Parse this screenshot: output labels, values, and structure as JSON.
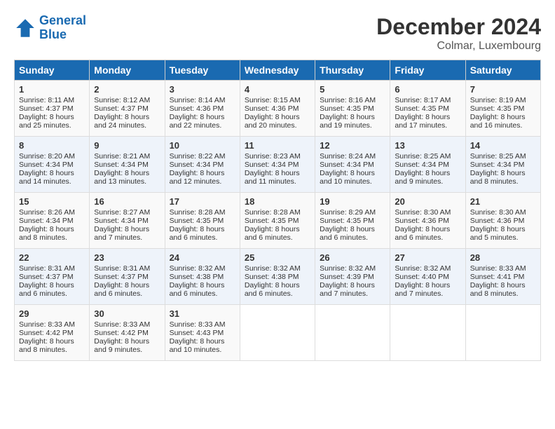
{
  "header": {
    "logo_line1": "General",
    "logo_line2": "Blue",
    "month": "December 2024",
    "location": "Colmar, Luxembourg"
  },
  "days_of_week": [
    "Sunday",
    "Monday",
    "Tuesday",
    "Wednesday",
    "Thursday",
    "Friday",
    "Saturday"
  ],
  "weeks": [
    [
      {
        "day": "1",
        "sunrise": "Sunrise: 8:11 AM",
        "sunset": "Sunset: 4:37 PM",
        "daylight": "Daylight: 8 hours and 25 minutes."
      },
      {
        "day": "2",
        "sunrise": "Sunrise: 8:12 AM",
        "sunset": "Sunset: 4:37 PM",
        "daylight": "Daylight: 8 hours and 24 minutes."
      },
      {
        "day": "3",
        "sunrise": "Sunrise: 8:14 AM",
        "sunset": "Sunset: 4:36 PM",
        "daylight": "Daylight: 8 hours and 22 minutes."
      },
      {
        "day": "4",
        "sunrise": "Sunrise: 8:15 AM",
        "sunset": "Sunset: 4:36 PM",
        "daylight": "Daylight: 8 hours and 20 minutes."
      },
      {
        "day": "5",
        "sunrise": "Sunrise: 8:16 AM",
        "sunset": "Sunset: 4:35 PM",
        "daylight": "Daylight: 8 hours and 19 minutes."
      },
      {
        "day": "6",
        "sunrise": "Sunrise: 8:17 AM",
        "sunset": "Sunset: 4:35 PM",
        "daylight": "Daylight: 8 hours and 17 minutes."
      },
      {
        "day": "7",
        "sunrise": "Sunrise: 8:19 AM",
        "sunset": "Sunset: 4:35 PM",
        "daylight": "Daylight: 8 hours and 16 minutes."
      }
    ],
    [
      {
        "day": "8",
        "sunrise": "Sunrise: 8:20 AM",
        "sunset": "Sunset: 4:34 PM",
        "daylight": "Daylight: 8 hours and 14 minutes."
      },
      {
        "day": "9",
        "sunrise": "Sunrise: 8:21 AM",
        "sunset": "Sunset: 4:34 PM",
        "daylight": "Daylight: 8 hours and 13 minutes."
      },
      {
        "day": "10",
        "sunrise": "Sunrise: 8:22 AM",
        "sunset": "Sunset: 4:34 PM",
        "daylight": "Daylight: 8 hours and 12 minutes."
      },
      {
        "day": "11",
        "sunrise": "Sunrise: 8:23 AM",
        "sunset": "Sunset: 4:34 PM",
        "daylight": "Daylight: 8 hours and 11 minutes."
      },
      {
        "day": "12",
        "sunrise": "Sunrise: 8:24 AM",
        "sunset": "Sunset: 4:34 PM",
        "daylight": "Daylight: 8 hours and 10 minutes."
      },
      {
        "day": "13",
        "sunrise": "Sunrise: 8:25 AM",
        "sunset": "Sunset: 4:34 PM",
        "daylight": "Daylight: 8 hours and 9 minutes."
      },
      {
        "day": "14",
        "sunrise": "Sunrise: 8:25 AM",
        "sunset": "Sunset: 4:34 PM",
        "daylight": "Daylight: 8 hours and 8 minutes."
      }
    ],
    [
      {
        "day": "15",
        "sunrise": "Sunrise: 8:26 AM",
        "sunset": "Sunset: 4:34 PM",
        "daylight": "Daylight: 8 hours and 8 minutes."
      },
      {
        "day": "16",
        "sunrise": "Sunrise: 8:27 AM",
        "sunset": "Sunset: 4:34 PM",
        "daylight": "Daylight: 8 hours and 7 minutes."
      },
      {
        "day": "17",
        "sunrise": "Sunrise: 8:28 AM",
        "sunset": "Sunset: 4:35 PM",
        "daylight": "Daylight: 8 hours and 6 minutes."
      },
      {
        "day": "18",
        "sunrise": "Sunrise: 8:28 AM",
        "sunset": "Sunset: 4:35 PM",
        "daylight": "Daylight: 8 hours and 6 minutes."
      },
      {
        "day": "19",
        "sunrise": "Sunrise: 8:29 AM",
        "sunset": "Sunset: 4:35 PM",
        "daylight": "Daylight: 8 hours and 6 minutes."
      },
      {
        "day": "20",
        "sunrise": "Sunrise: 8:30 AM",
        "sunset": "Sunset: 4:36 PM",
        "daylight": "Daylight: 8 hours and 6 minutes."
      },
      {
        "day": "21",
        "sunrise": "Sunrise: 8:30 AM",
        "sunset": "Sunset: 4:36 PM",
        "daylight": "Daylight: 8 hours and 5 minutes."
      }
    ],
    [
      {
        "day": "22",
        "sunrise": "Sunrise: 8:31 AM",
        "sunset": "Sunset: 4:37 PM",
        "daylight": "Daylight: 8 hours and 6 minutes."
      },
      {
        "day": "23",
        "sunrise": "Sunrise: 8:31 AM",
        "sunset": "Sunset: 4:37 PM",
        "daylight": "Daylight: 8 hours and 6 minutes."
      },
      {
        "day": "24",
        "sunrise": "Sunrise: 8:32 AM",
        "sunset": "Sunset: 4:38 PM",
        "daylight": "Daylight: 8 hours and 6 minutes."
      },
      {
        "day": "25",
        "sunrise": "Sunrise: 8:32 AM",
        "sunset": "Sunset: 4:38 PM",
        "daylight": "Daylight: 8 hours and 6 minutes."
      },
      {
        "day": "26",
        "sunrise": "Sunrise: 8:32 AM",
        "sunset": "Sunset: 4:39 PM",
        "daylight": "Daylight: 8 hours and 7 minutes."
      },
      {
        "day": "27",
        "sunrise": "Sunrise: 8:32 AM",
        "sunset": "Sunset: 4:40 PM",
        "daylight": "Daylight: 8 hours and 7 minutes."
      },
      {
        "day": "28",
        "sunrise": "Sunrise: 8:33 AM",
        "sunset": "Sunset: 4:41 PM",
        "daylight": "Daylight: 8 hours and 8 minutes."
      }
    ],
    [
      {
        "day": "29",
        "sunrise": "Sunrise: 8:33 AM",
        "sunset": "Sunset: 4:42 PM",
        "daylight": "Daylight: 8 hours and 8 minutes."
      },
      {
        "day": "30",
        "sunrise": "Sunrise: 8:33 AM",
        "sunset": "Sunset: 4:42 PM",
        "daylight": "Daylight: 8 hours and 9 minutes."
      },
      {
        "day": "31",
        "sunrise": "Sunrise: 8:33 AM",
        "sunset": "Sunset: 4:43 PM",
        "daylight": "Daylight: 8 hours and 10 minutes."
      },
      null,
      null,
      null,
      null
    ]
  ]
}
